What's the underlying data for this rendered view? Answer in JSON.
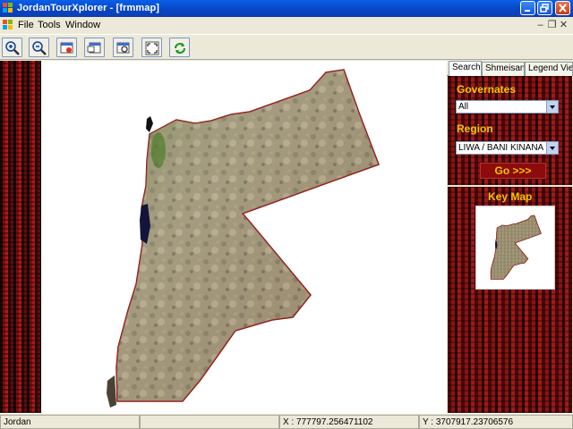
{
  "window": {
    "title": "JordanTourXplorer - [frmmap]"
  },
  "menu": {
    "items": [
      "File",
      "Tools",
      "Window"
    ]
  },
  "toolbar": {
    "buttons": [
      {
        "icon": "zoom-in-icon"
      },
      {
        "icon": "zoom-out-icon"
      },
      {
        "icon": "select-area-icon"
      },
      {
        "icon": "pan-window-icon"
      },
      {
        "icon": "identify-icon"
      },
      {
        "icon": "full-extent-icon"
      },
      {
        "icon": "refresh-icon"
      }
    ]
  },
  "tabs": [
    "Search",
    "Shmeisani",
    "Legend View"
  ],
  "search": {
    "governates_label": "Governates",
    "governates_value": "All",
    "region_label": "Region",
    "region_value": "LIWA / BANI KINANA",
    "go_label": "Go >>>"
  },
  "keymap": {
    "title": "Key Map"
  },
  "status": {
    "left": "Jordan",
    "x": "X : 777797.256471102",
    "y": "Y : 3707917.23706576"
  },
  "colors": {
    "panel_gold": "#f5c400",
    "map_border": "#8b1010"
  }
}
